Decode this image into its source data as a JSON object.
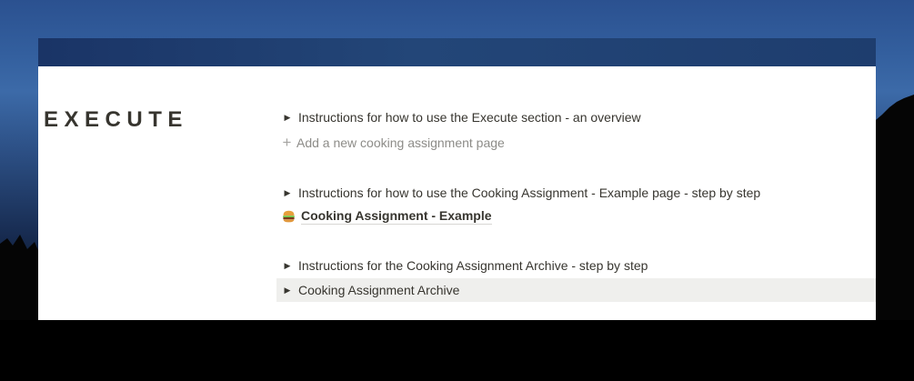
{
  "execute": {
    "heading": "EXECUTE",
    "items": [
      {
        "type": "toggle",
        "label": "Instructions for how to use the Execute section - an overview"
      },
      {
        "type": "add",
        "icon": "plus-icon",
        "label": "Add a new cooking assignment page"
      },
      {
        "type": "toggle",
        "label": "Instructions for how to use the Cooking Assignment - Example page - step by step"
      },
      {
        "type": "page",
        "icon": "hamburger-icon",
        "label": "Cooking Assignment - Example"
      },
      {
        "type": "toggle",
        "label": "Instructions for the Cooking Assignment Archive - step by step"
      },
      {
        "type": "toggle",
        "label": "Cooking Assignment Archive",
        "highlighted": true
      }
    ]
  },
  "colors": {
    "text": "#37352f",
    "muted": "#8d8c88",
    "banner": "#1e3d6e",
    "highlight": "#efefed"
  }
}
